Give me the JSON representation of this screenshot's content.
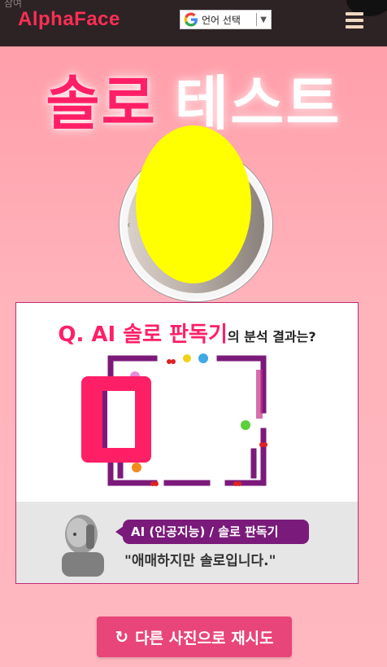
{
  "header": {
    "participate_label": "참여",
    "brand": "AlphaFace",
    "translate_label": "언어 선택",
    "translate_arrow": "▼",
    "menu_icon": "hamburger-menu-icon"
  },
  "hero": {
    "title_part1": "솔로",
    "title_part2": "테스트"
  },
  "result": {
    "question_big": "Q. AI 솔로 판독기",
    "question_small": "의 분석 결과는?",
    "score": "0",
    "ai_tag": "AI (인공지능) / 솔로 판독기",
    "verdict": "\"애매하지만  솔로입니다.\""
  },
  "actions": {
    "retry_icon": "↻",
    "retry_label": "다른 사진으로 재시도"
  },
  "colors": {
    "accent": "#ff1f67",
    "purple": "#7a1a7a",
    "button": "#e8457a"
  }
}
